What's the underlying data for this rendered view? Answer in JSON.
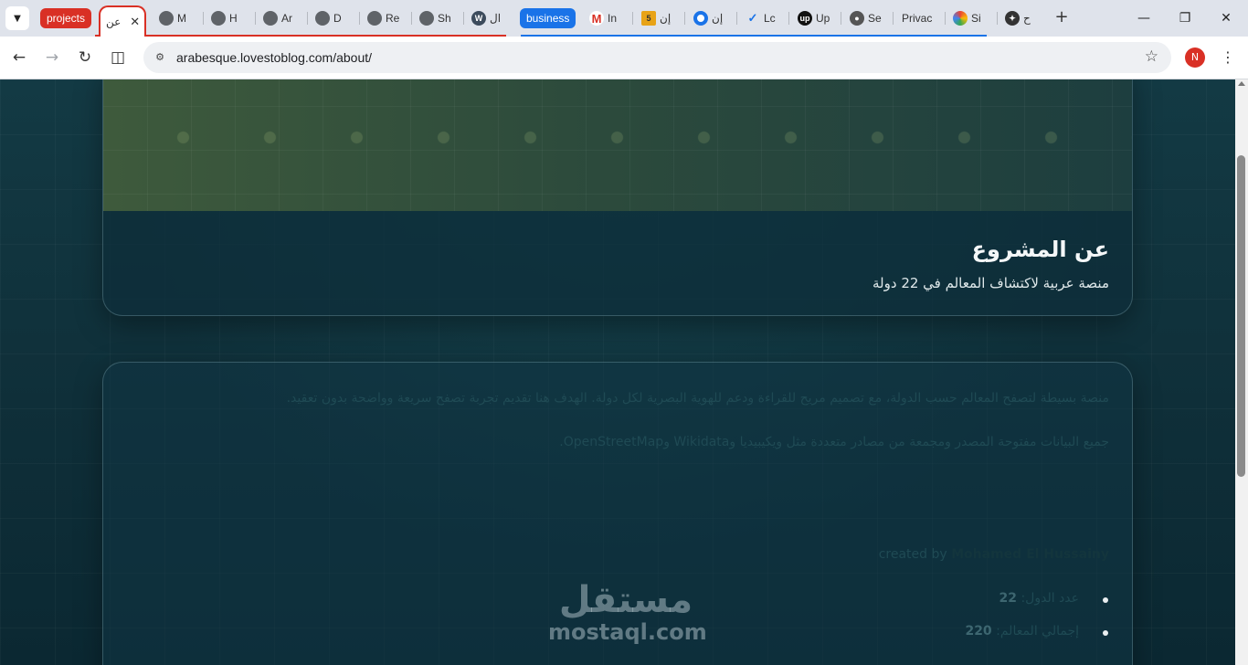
{
  "browser": {
    "groups": [
      {
        "label": "projects",
        "color": "#d93025"
      },
      {
        "label": "business",
        "color": "#1a73e8"
      }
    ],
    "tabs": [
      {
        "title": "عن",
        "icon": "globe-icon"
      },
      {
        "title": "M",
        "icon": "globe-icon"
      },
      {
        "title": "H",
        "icon": "globe-icon"
      },
      {
        "title": "Ar",
        "icon": "globe-icon"
      },
      {
        "title": "D",
        "icon": "globe-icon"
      },
      {
        "title": "Re",
        "icon": "globe-icon"
      },
      {
        "title": "Sh",
        "icon": "globe-icon"
      },
      {
        "title": "ال",
        "icon": "wordpress-icon"
      },
      {
        "title": "In",
        "icon": "gmail-icon"
      },
      {
        "title": "إن",
        "icon": "number-5-icon"
      },
      {
        "title": "إن",
        "icon": "ring-icon"
      },
      {
        "title": "Lc",
        "icon": "check-icon"
      },
      {
        "title": "Up",
        "icon": "upwork-icon"
      },
      {
        "title": "Se",
        "icon": "github-icon"
      },
      {
        "title": "Privac",
        "icon": ""
      },
      {
        "title": "Si",
        "icon": "google-icon"
      },
      {
        "title": "ح",
        "icon": "openai-icon"
      }
    ],
    "url": "arabesque.lovestoblog.com/about/",
    "profile_initial": "N"
  },
  "page": {
    "hero": {
      "title": "عن المشروع",
      "subtitle": "منصة عربية لاكتشاف المعالم في 22 دولة"
    },
    "about": {
      "paragraph_1": "منصة بسيطة لتصفح المعالم حسب الدولة، مع تصميم مريح للقراءة ودعم للهوية البصرية لكل دولة. الهدف هنا تقديم تجربة تصفح سريعة وواضحة بدون تعقيد.",
      "paragraph_2": "جميع البيانات مفتوحة المصدر ومجمعة من مصادر متعددة مثل ويكيبيديا وWikidata وOpenStreetMap.",
      "credit_prefix": "created by",
      "credit_name": "Mohamed El Hussainy",
      "stats": [
        {
          "label": "عدد الدول:",
          "value": "22"
        },
        {
          "label": "إجمالي المعالم:",
          "value": "220"
        }
      ]
    }
  },
  "watermark": {
    "arabic": "مستقل",
    "latin": "mostaql.com"
  }
}
